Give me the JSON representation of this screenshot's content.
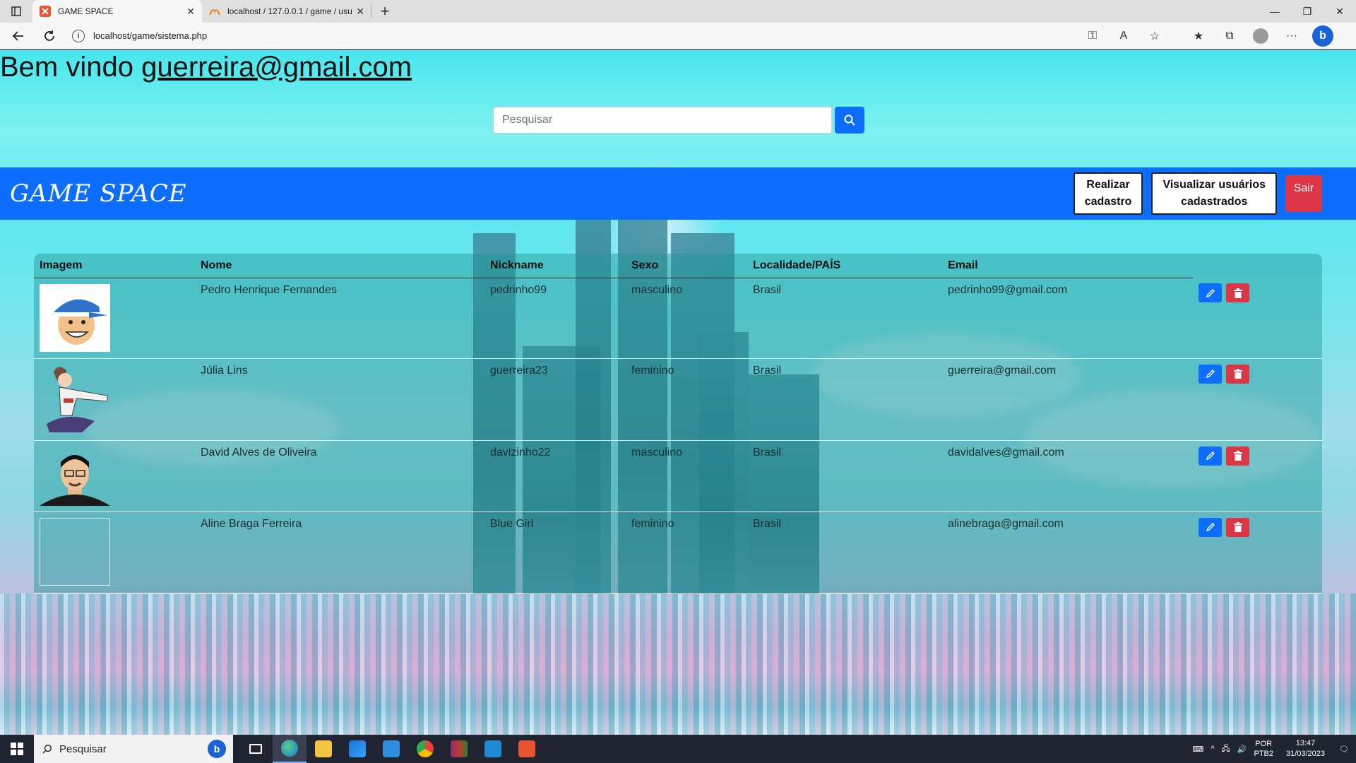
{
  "browser": {
    "tabs": [
      {
        "title": "GAME SPACE",
        "active": true
      },
      {
        "title": "localhost / 127.0.0.1 / game / usu",
        "active": false
      }
    ],
    "url": "localhost/game/sistema.php"
  },
  "page": {
    "welcome_prefix": "Bem vindo ",
    "welcome_email": "guerreira@gmail.com",
    "search_placeholder": "Pesquisar",
    "brand": "GAME SPACE",
    "nav": {
      "register_line1": "Realizar",
      "register_line2": "cadastro",
      "view_users_line1": "Visualizar usuários",
      "view_users_line2": "cadastrados",
      "logout": "Sair"
    },
    "table": {
      "headers": [
        "Imagem",
        "Nome",
        "Nickname",
        "Sexo",
        "Localidade/PAÍS",
        "Email"
      ],
      "rows": [
        {
          "name": "Pedro Henrique Fernandes",
          "nickname": "pedrinho99",
          "sexo": "masculino",
          "local": "Brasil",
          "email": "pedrinho99@gmail.com"
        },
        {
          "name": "Júlia Lins",
          "nickname": "guerreira23",
          "sexo": "feminino",
          "local": "Brasil",
          "email": "guerreira@gmail.com"
        },
        {
          "name": "David Alves de Oliveira",
          "nickname": "davizinho22",
          "sexo": "masculino",
          "local": "Brasil",
          "email": "davidalves@gmail.com"
        },
        {
          "name": "Aline Braga Ferreira",
          "nickname": "Blue Girl",
          "sexo": "feminino",
          "local": "Brasil",
          "email": "alinebraga@gmail.com"
        }
      ]
    }
  },
  "taskbar": {
    "search_placeholder": "Pesquisar",
    "lang_line1": "POR",
    "lang_line2": "PTB2",
    "time": "13:47",
    "date": "31/03/2023"
  },
  "colors": {
    "primary": "#0d6efd",
    "danger": "#dc3545"
  }
}
